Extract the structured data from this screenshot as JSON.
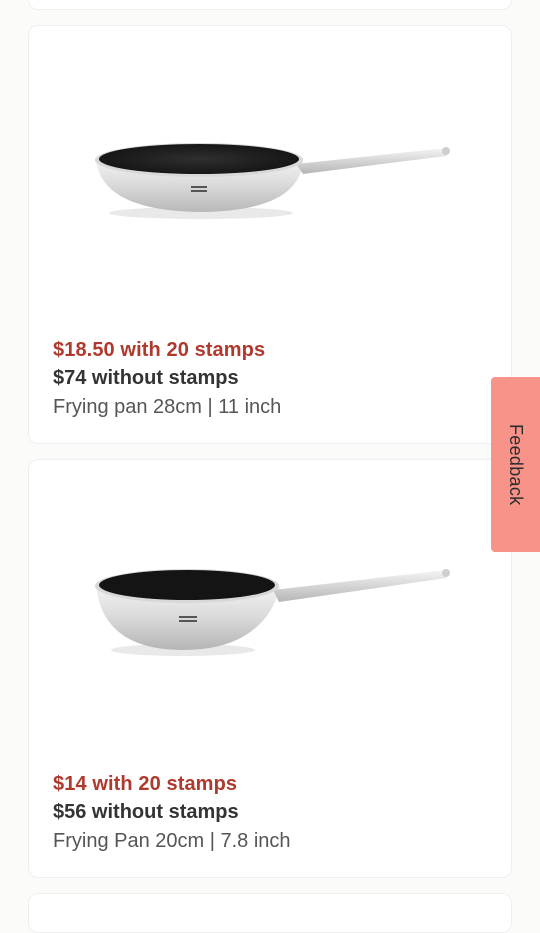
{
  "products": [
    {
      "price_with_stamps": "$18.50 with 20 stamps",
      "price_without_stamps": "$74 without stamps",
      "name": "Frying pan 28cm | 11 inch",
      "image_icon": "frying-pan-image"
    },
    {
      "price_with_stamps": "$14 with 20 stamps",
      "price_without_stamps": "$56 without stamps",
      "name": "Frying Pan 20cm | 7.8 inch",
      "image_icon": "frying-pan-image"
    }
  ],
  "feedback": {
    "label": "Feedback",
    "color": "#f8938a"
  },
  "colors": {
    "stamp_price": "#b0392e",
    "regular_price": "#333333"
  }
}
